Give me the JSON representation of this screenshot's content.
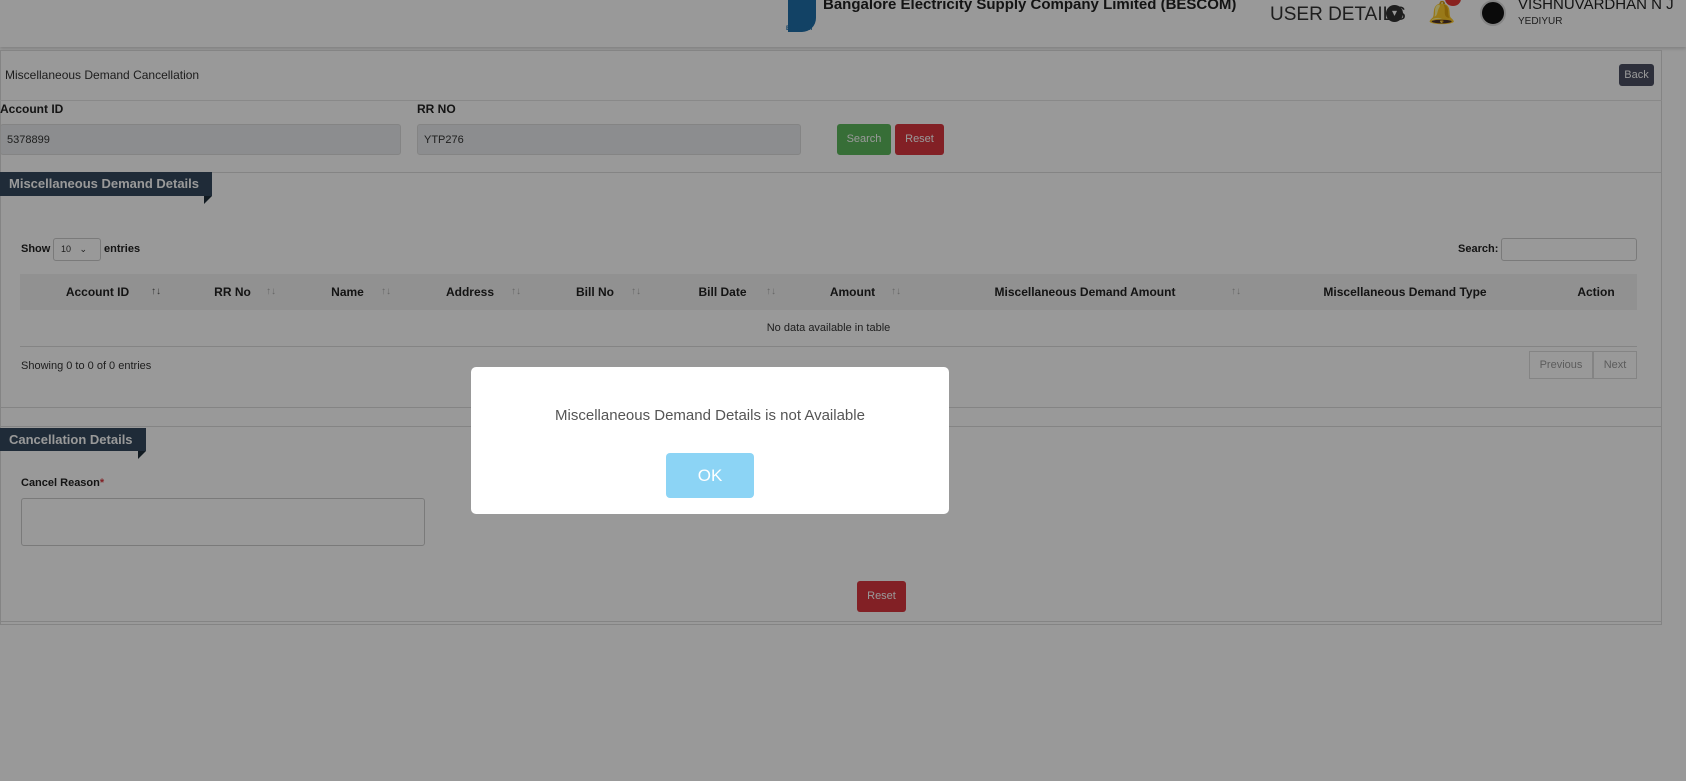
{
  "header": {
    "company": "Bangalore Electricity Supply Company Limited (BESCOM)",
    "logo_text": "BESCOM",
    "user_details": "USER DETAILS",
    "user_name": "VISHNUVARDHAN N J",
    "user_location": "YEDIYUR"
  },
  "page": {
    "title": "Miscellaneous Demand Cancellation",
    "back": "Back"
  },
  "search": {
    "account_label": "Account ID",
    "account_value": "5378899",
    "rr_label": "RR NO",
    "rr_value": "YTP276",
    "search_btn": "Search",
    "reset_btn": "Reset"
  },
  "details": {
    "title": "Miscellaneous Demand Details",
    "show": "Show",
    "entries_value": "10",
    "entries": "entries",
    "search_label": "Search:",
    "columns": [
      "Account ID",
      "RR No",
      "Name",
      "Address",
      "Bill No",
      "Bill Date",
      "Amount",
      "Miscellaneous Demand Amount",
      "Miscellaneous Demand Type",
      "Action"
    ],
    "sort_icon": "↑↓",
    "empty": "No data available in table",
    "showing": "Showing 0 to 0 of 0 entries",
    "previous": "Previous",
    "next": "Next"
  },
  "cancel": {
    "title": "Cancellation Details",
    "reason_label": "Cancel Reason",
    "required": "*",
    "reset": "Reset"
  },
  "modal": {
    "message": "Miscellaneous Demand Details is not Available",
    "ok": "OK"
  }
}
